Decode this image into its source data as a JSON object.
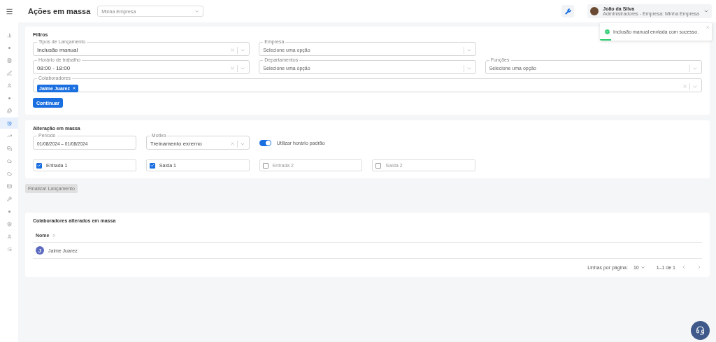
{
  "sidebar": {
    "items": [
      {
        "kind": "chart",
        "selected": false
      },
      {
        "kind": "dot",
        "selected": false
      },
      {
        "kind": "file",
        "selected": false
      },
      {
        "kind": "pen",
        "selected": false
      },
      {
        "kind": "user",
        "selected": false
      },
      {
        "kind": "dot",
        "selected": false
      },
      {
        "kind": "files",
        "selected": false
      },
      {
        "kind": "alarm",
        "selected": true
      },
      {
        "kind": "trend",
        "selected": false
      },
      {
        "kind": "chat",
        "selected": false
      },
      {
        "kind": "cloud",
        "selected": false
      },
      {
        "kind": "cloud",
        "selected": false
      },
      {
        "kind": "mail",
        "selected": false
      },
      {
        "kind": "wrench",
        "selected": false
      },
      {
        "kind": "dot",
        "selected": false
      },
      {
        "kind": "gear",
        "selected": false
      },
      {
        "kind": "user",
        "selected": false
      },
      {
        "kind": "listcheck",
        "selected": false
      }
    ]
  },
  "header": {
    "title": "Ações em massa",
    "company_select": "Minha Empresa",
    "user": {
      "name": "João da Silva",
      "role": "Administradores - Empresa: Minha Empresa"
    }
  },
  "toast": {
    "message": "Inclusão manual enviada com sucesso.",
    "level": 0.1
  },
  "filters": {
    "title": "Filtros",
    "rows": [
      {
        "fields": [
          {
            "label": "Tipos de Lançamento",
            "value": "Inclusão manual",
            "clearable": true
          },
          {
            "label": "Empresa",
            "placeholder": "Selecione uma opção",
            "clearable": false
          }
        ]
      },
      {
        "fields": [
          {
            "label": "Horário de trabalho",
            "value": "08:00 - 18:00",
            "clearable": true
          },
          {
            "label": "Departamentos",
            "placeholder": "Selecione uma opção",
            "clearable": false
          },
          {
            "label": "Funções",
            "placeholder": "Selecione uma opção",
            "clearable": false
          }
        ]
      }
    ],
    "collaborators": {
      "label": "Colaboradores",
      "chips": [
        "Jaime Juarez"
      ]
    },
    "button": "Continuar"
  },
  "mass_change": {
    "title": "Alteração em massa",
    "period": {
      "label": "Período",
      "value": "01/08/2024 – 01/08/2024"
    },
    "reason": {
      "label": "Motivo",
      "value": "Treinamento exrerno"
    },
    "toggle": {
      "label": "Utilizar horário padrão",
      "on": true
    },
    "checks": [
      {
        "label": "Entrada 1",
        "checked": true
      },
      {
        "label": "Saída 1",
        "checked": true
      },
      {
        "label": "Entrada 2",
        "checked": false
      },
      {
        "label": "Saída 2",
        "checked": false
      }
    ]
  },
  "finalize_button": {
    "label": "Finalizar Lançamento",
    "disabled": true
  },
  "table": {
    "title": "Colaboradores alterados em massa",
    "columns": [
      "Nome"
    ],
    "rows": [
      {
        "initial": "J",
        "name": "Jaime Juarez"
      }
    ],
    "pagination": {
      "rows_label": "Linhas por página:",
      "rows_value": "10",
      "range": "1–1 de 1"
    }
  }
}
